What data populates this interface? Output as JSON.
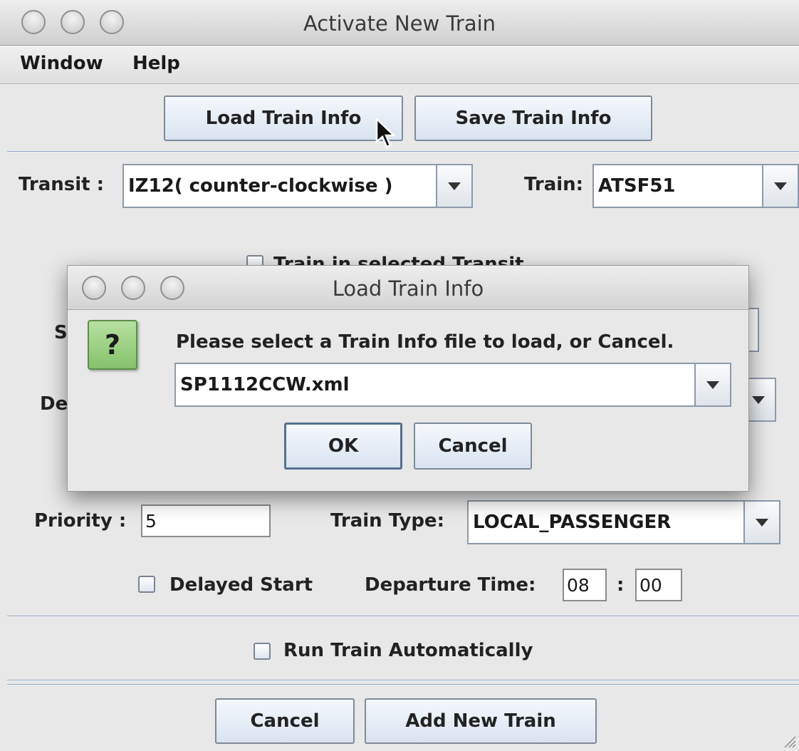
{
  "window": {
    "title": "Activate New Train"
  },
  "menubar": {
    "items": [
      "Window",
      "Help"
    ]
  },
  "toolbar": {
    "load_label": "Load Train Info",
    "save_label": "Save Train Info"
  },
  "form": {
    "transit_label": "Transit :",
    "transit_value": "IZ12( counter-clockwise )",
    "train_label": "Train:",
    "train_value": "ATSF51",
    "in_transit_label": "Train in selected Transit",
    "start_label_partial": "S",
    "dest_label_partial": "De",
    "priority_label": "Priority :",
    "priority_value": "5",
    "train_type_label": "Train Type:",
    "train_type_value": "LOCAL_PASSENGER",
    "delayed_start_label": "Delayed Start",
    "departure_label": "Departure Time:",
    "departure_hour": "08",
    "departure_sep": ":",
    "departure_min": "00",
    "auto_run_label": "Run Train Automatically"
  },
  "footer": {
    "cancel_label": "Cancel",
    "add_label": "Add New Train"
  },
  "dialog": {
    "title": "Load Train Info",
    "icon": "question-icon",
    "icon_glyph": "?",
    "message": "Please select a Train Info file to load, or Cancel.",
    "file_value": "SP1112CCW.xml",
    "ok_label": "OK",
    "cancel_label": "Cancel"
  },
  "colors": {
    "accent": "#8fa6c6",
    "icon_bg": "#9fd088"
  }
}
